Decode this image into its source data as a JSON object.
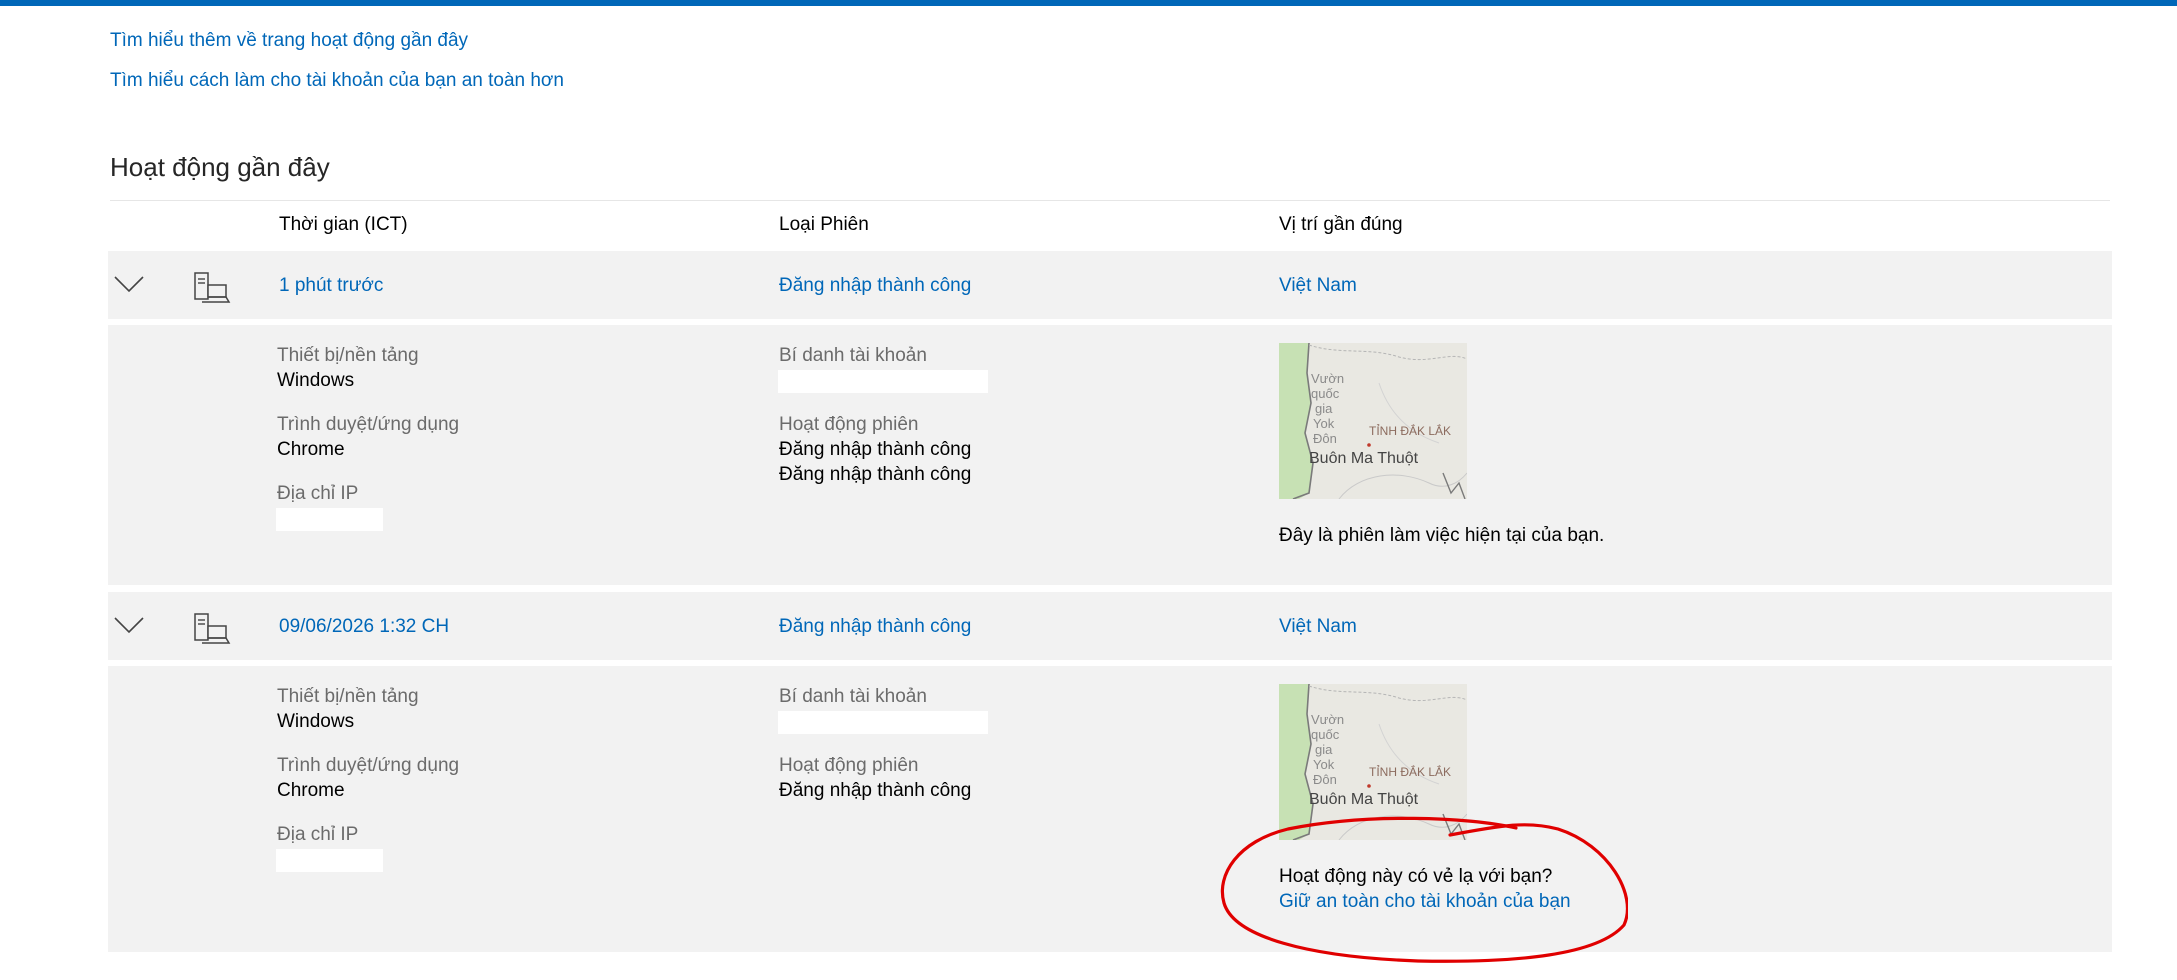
{
  "top_links": {
    "learn_recent": "Tìm hiểu thêm về trang hoạt động gần đây",
    "learn_secure": "Tìm hiểu cách làm cho tài khoản của bạn an toàn hơn"
  },
  "section_title": "Hoạt động gần đây",
  "columns": {
    "time": "Thời gian (ICT)",
    "session_type": "Loại Phiên",
    "location": "Vị trí gần đúng"
  },
  "labels": {
    "device": "Thiết bị/nền tảng",
    "browser": "Trình duyệt/ứng dụng",
    "ip": "Địa chỉ IP",
    "alias": "Bí danh tài khoản",
    "session_activity": "Hoạt động phiên"
  },
  "map": {
    "park": "Vườn quốc gia Yok Đôn",
    "park_lines": [
      "Vườn",
      "quốc",
      "gia",
      "Yok",
      "Đôn"
    ],
    "province": "TỈNH ĐẮK LẮK",
    "city": "Buôn Ma Thuột"
  },
  "sessions": [
    {
      "time": "1 phút trước",
      "type": "Đăng nhập thành công",
      "location": "Việt Nam",
      "device": "Windows",
      "browser": "Chrome",
      "activities": [
        "Đăng nhập thành công",
        "Đăng nhập thành công"
      ],
      "note": "Đây là phiên làm việc hiện tại của bạn."
    },
    {
      "time": "09/06/2026 1:32 CH",
      "type": "Đăng nhập thành công",
      "location": "Việt Nam",
      "device": "Windows",
      "browser": "Chrome",
      "activities": [
        "Đăng nhập thành công"
      ],
      "note": "Hoạt động này có vẻ lạ với bạn?",
      "secure_link": "Giữ an toàn cho tài khoản của bạn"
    }
  ],
  "colors": {
    "accent": "#0067b8",
    "row_bg": "#f2f2f2",
    "annotation": "#e00000"
  },
  "icons": [
    "chevron-down-icon",
    "computer-icon",
    "map-thumbnail"
  ]
}
